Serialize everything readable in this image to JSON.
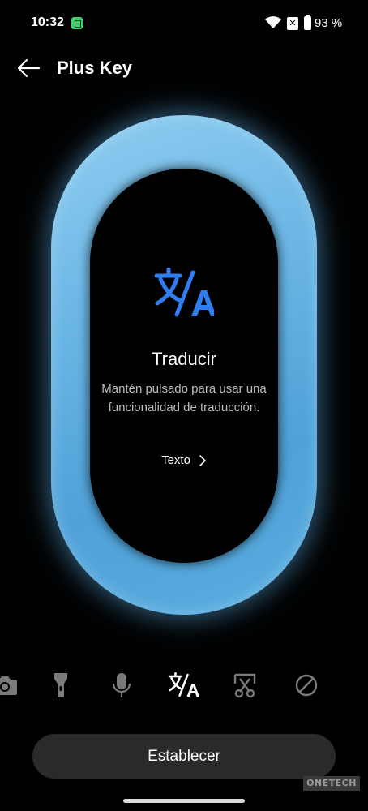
{
  "status_bar": {
    "time": "10:32",
    "battery": "93 %",
    "sim_glyph": "✕"
  },
  "header": {
    "title": "Plus Key"
  },
  "feature": {
    "icon": "translate-icon",
    "title": "Traducir",
    "description": "Mantén pulsado para usar una funcionalidad de traducción.",
    "link_label": "Texto"
  },
  "options": [
    {
      "name": "camera",
      "icon": "camera-icon",
      "selected": false
    },
    {
      "name": "flashlight",
      "icon": "flashlight-icon",
      "selected": false
    },
    {
      "name": "voice",
      "icon": "microphone-icon",
      "selected": false
    },
    {
      "name": "translate",
      "icon": "translate-icon",
      "selected": true
    },
    {
      "name": "screenshot",
      "icon": "screenshot-scissors-icon",
      "selected": false
    },
    {
      "name": "none",
      "icon": "no-action-icon",
      "selected": false
    }
  ],
  "actions": {
    "set_label": "Establecer"
  },
  "watermark": "ONETECH",
  "colors": {
    "accent": "#2f7df0",
    "ring": "#6cb7e6",
    "button": "#2a2a2a"
  }
}
